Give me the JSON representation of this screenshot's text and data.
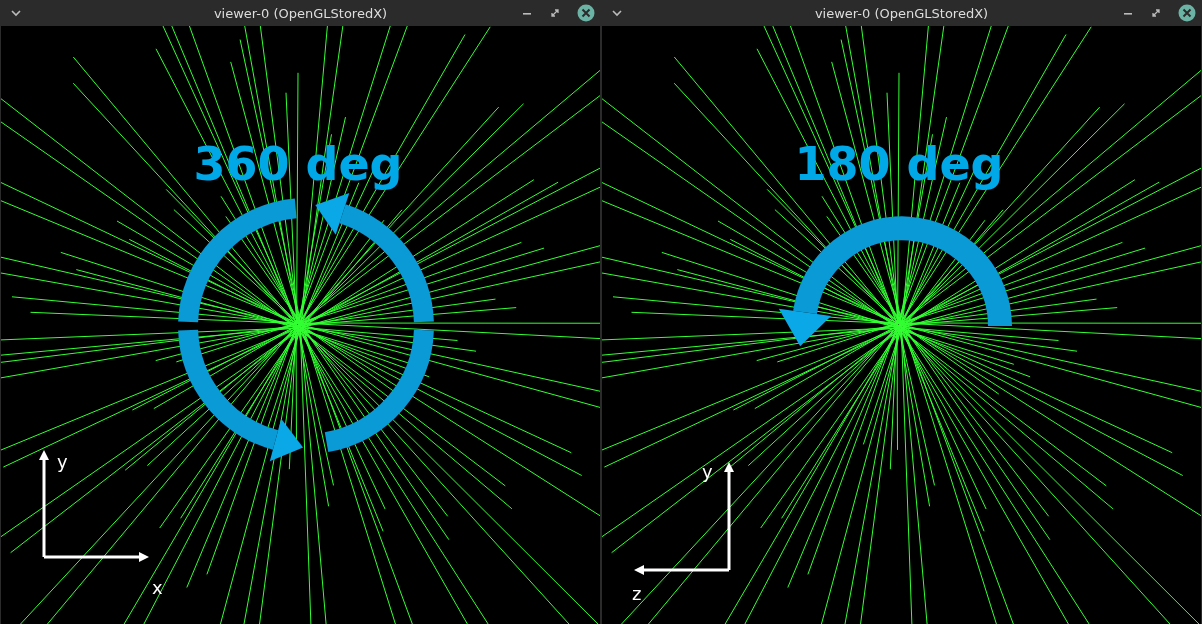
{
  "windows": [
    {
      "title": "viewer-0 (OpenGLStoredX)",
      "annotation": "360 deg",
      "rotation": {
        "kind": "full"
      },
      "axes": {
        "vertical_label": "y",
        "horizontal_label": "x",
        "horizontal_points_left": false
      }
    },
    {
      "title": "viewer-0 (OpenGLStoredX)",
      "annotation": "180 deg",
      "rotation": {
        "kind": "half"
      },
      "axes": {
        "vertical_label": "y",
        "horizontal_label": "z",
        "horizontal_points_left": true
      }
    }
  ]
}
